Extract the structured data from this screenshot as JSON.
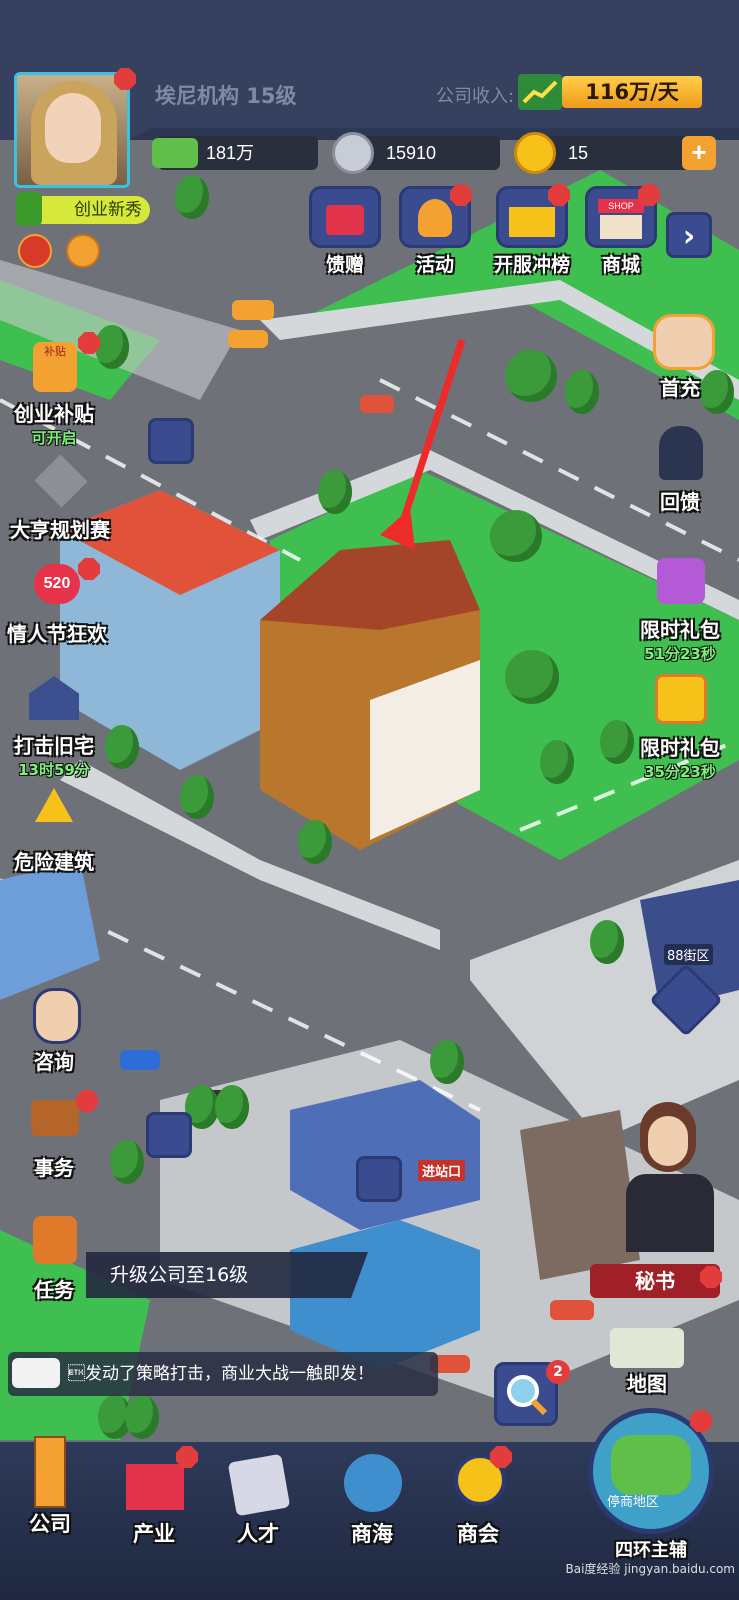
{
  "header": {
    "company_name": "埃尼机构 15级",
    "income_label": "公司收入:",
    "income_value": "116万/天",
    "title_badge": "创业新秀"
  },
  "resources": {
    "cash": "181万",
    "silver": "15910",
    "gold": "15",
    "add_symbol": "+"
  },
  "top_buttons": [
    {
      "label": "馈赠"
    },
    {
      "label": "活动"
    },
    {
      "label": "开服冲榜"
    },
    {
      "label": "商城"
    }
  ],
  "left_buttons": [
    {
      "label": "创业补贴",
      "sub": "可开启"
    },
    {
      "label": "大亨规划赛",
      "sub": ""
    },
    {
      "label": "情人节狂欢",
      "sub": ""
    },
    {
      "label": "打击旧宅",
      "sub": "13时59分"
    },
    {
      "label": "危险建筑",
      "sub": ""
    },
    {
      "label": "咨询",
      "sub": ""
    },
    {
      "label": "事务",
      "sub": ""
    },
    {
      "label": "任务",
      "sub": ""
    }
  ],
  "right_buttons": [
    {
      "label": "首充",
      "sub": ""
    },
    {
      "label": "回馈",
      "sub": ""
    },
    {
      "label": "限时礼包",
      "sub": "51分23秒"
    },
    {
      "label": "限时礼包",
      "sub": "35分23秒"
    }
  ],
  "map": {
    "district_label": "88街区",
    "station_sign": "进站口",
    "secretary_label": "秘书",
    "map_label": "地图",
    "search_badge": "2",
    "gift_520": "520",
    "subsidy_tag": "补贴",
    "shop_sign": "SHOP"
  },
  "task_banner": "升级公司至16级",
  "chat_message": "\u0003发动了策略打击，商业大战一触即发！",
  "bottom_nav": [
    {
      "label": "公司"
    },
    {
      "label": "产业"
    },
    {
      "label": "人才"
    },
    {
      "label": "商海"
    },
    {
      "label": "商会"
    },
    {
      "label": "四环主辅"
    }
  ],
  "location_label": "停商地区",
  "watermark": "Bai度经验 jingyan.baidu.com",
  "colors": {
    "badge_red": "#e23c3c",
    "accent_cyan": "#35c3e6",
    "grass": "#3fbf4f",
    "road": "#6d7178",
    "arrow": "#ee2a2a"
  }
}
